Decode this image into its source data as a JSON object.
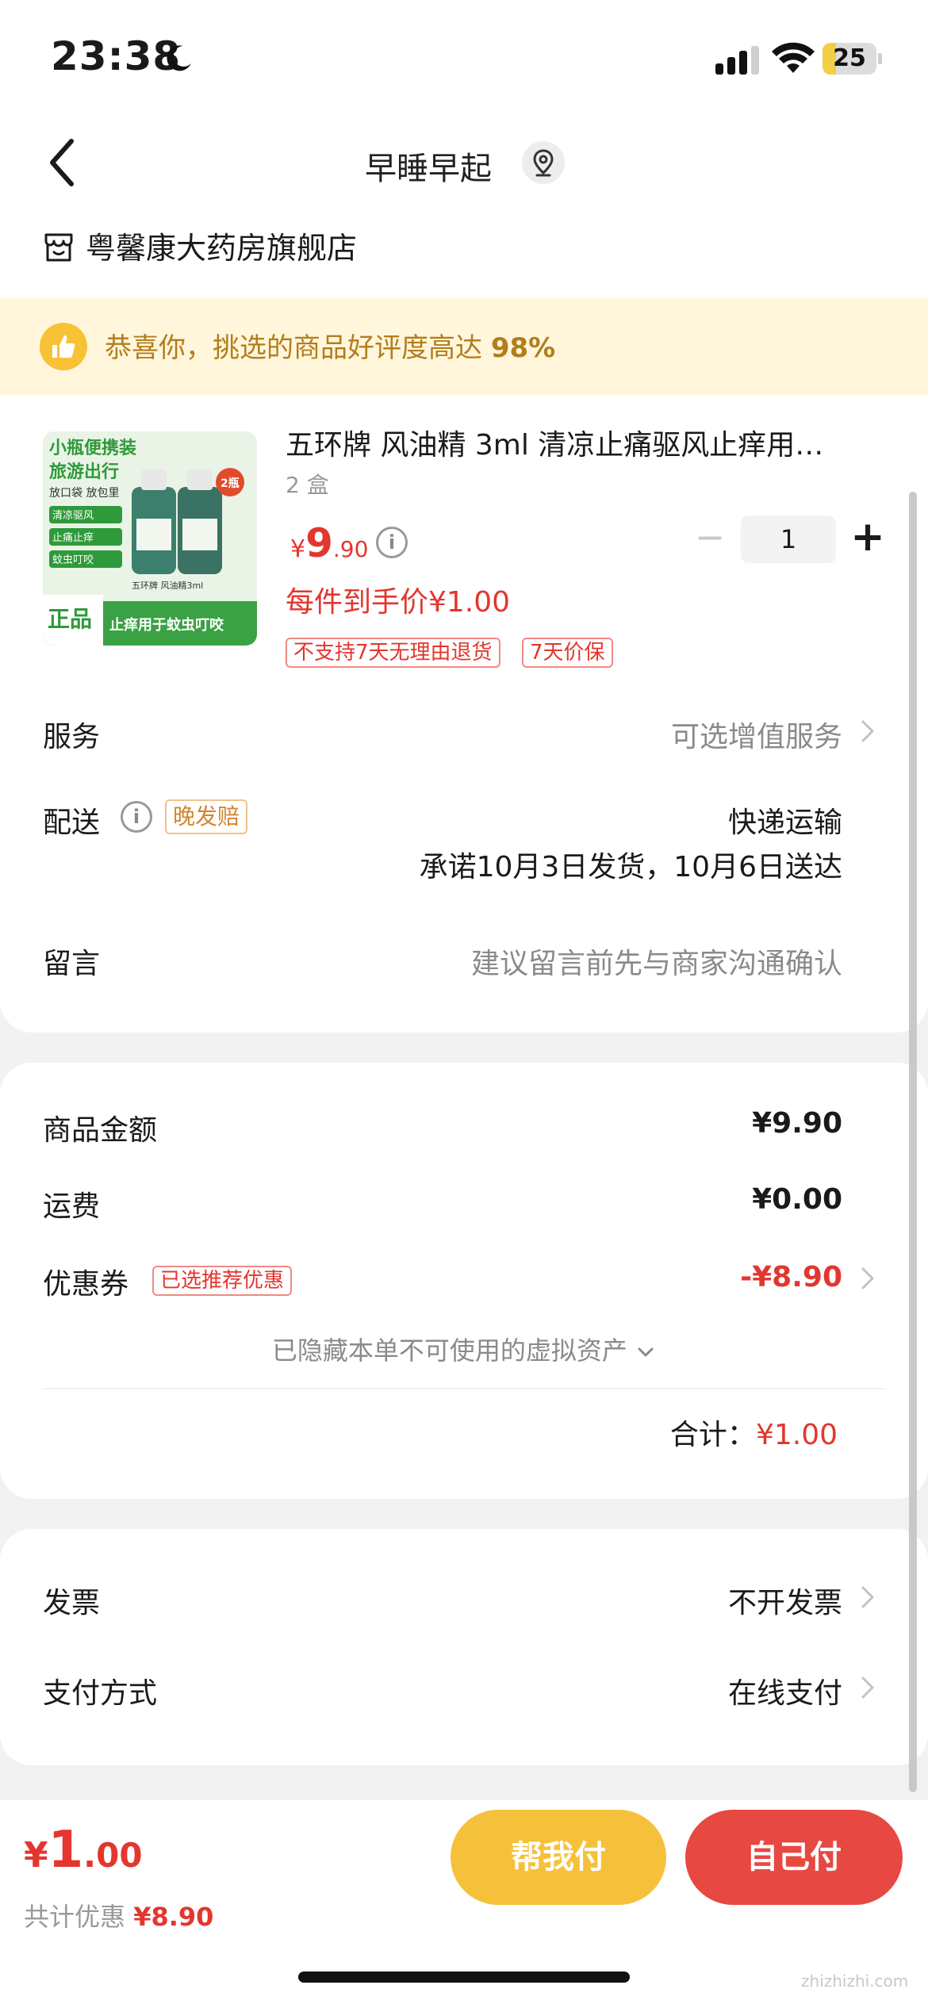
{
  "status_bar": {
    "time": "23:38",
    "battery": "25",
    "battery_level": 0.25
  },
  "nav": {
    "title": "早睡早起"
  },
  "store": {
    "name": "粤馨康大药房旗舰店"
  },
  "banner": {
    "text_prefix": "恭喜你，挑选的商品好评度高达",
    "text_highlight": "98%"
  },
  "product": {
    "image_lines": [
      "小瓶便携装",
      "旅游出行",
      "放口袋 放包里",
      "清凉驱风",
      "止痛止痒",
      "蚊虫叮咬",
      "正品",
      "止痒用于蚊虫叮咬",
      "五环牌 风油精3ml",
      "2瓶"
    ],
    "title": "五环牌 风油精 3ml 清凉止痛驱风止痒用…",
    "spec": "2 盒",
    "price_currency": "¥",
    "price_int": "9",
    "price_dec": ".90",
    "quantity": "1",
    "unit_price": "每件到手价¥1.00",
    "tags": [
      "不支持7天无理由退货",
      "7天价保"
    ]
  },
  "order": {
    "service_label": "服务",
    "service_value": "可选增值服务",
    "delivery_label": "配送",
    "delivery_tag": "晚发赔",
    "delivery_method": "快递运输",
    "delivery_date": "承诺10月3日发货，10月6日送达",
    "message_label": "留言",
    "message_hint": "建议留言前先与商家沟通确认"
  },
  "breakdown": {
    "goods_label": "商品金额",
    "goods_value": "¥9.90",
    "shipping_label": "运费",
    "shipping_value": "¥0.00",
    "coupon_label": "优惠券",
    "coupon_tag": "已选推荐优惠",
    "coupon_value": "-¥8.90",
    "hidden_assets": "已隐藏本单不可使用的虚拟资产",
    "total_label": "合计：",
    "total_value": "¥1.00"
  },
  "invoice": {
    "invoice_label": "发票",
    "invoice_value": "不开发票",
    "payment_label": "支付方式",
    "payment_value": "在线支付"
  },
  "bottom": {
    "price_currency": "¥",
    "price_int": "1",
    "price_dec": ".00",
    "discount_label": "共计优惠",
    "discount_value": "¥8.90",
    "help_pay": "帮我付",
    "self_pay": "自己付"
  },
  "watermark": "zhizhizhi.com",
  "colors": {
    "accent_red": "#e3362f",
    "help_yellow": "#f6c13a",
    "pay_red": "#e84842",
    "banner_bg": "#fff6dc"
  }
}
